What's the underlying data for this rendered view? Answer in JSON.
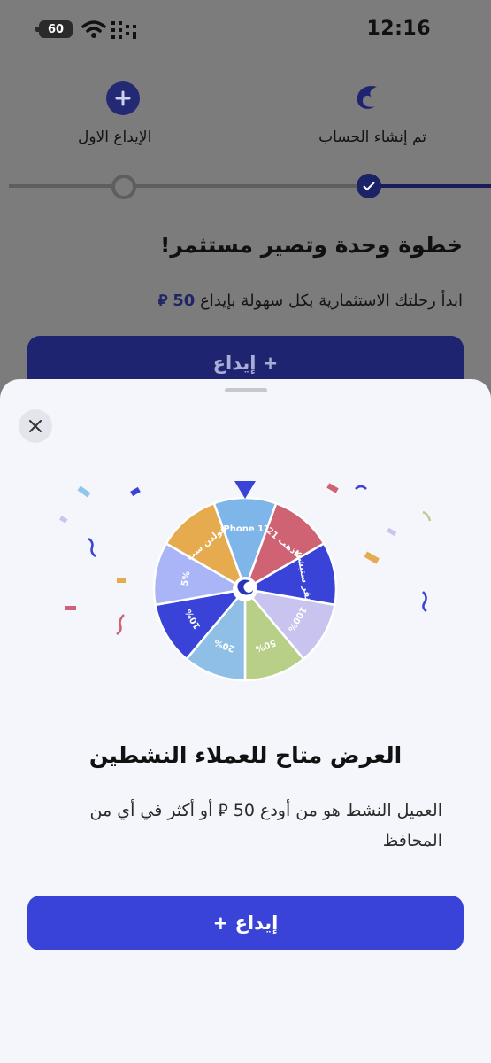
{
  "status_bar": {
    "time": "12:16",
    "battery": "60"
  },
  "background": {
    "steps": [
      {
        "label": "تم إنشاء الحساب"
      },
      {
        "label": "الإيداع الاول"
      }
    ],
    "heading": "خطوة وحدة وتصير مستثمر!",
    "subtitle_text": "ابدأ رحلتك الاستثمارية بكل سهولة بإيداع",
    "subtitle_amount": "50",
    "deposit_button": "إيداع +"
  },
  "sheet": {
    "wheel_segments": [
      {
        "label": "iPhone 17",
        "color": "#7fb6ea"
      },
      {
        "label": "ذهب 21K",
        "color": "#cf6273"
      },
      {
        "label": "هنقر ستيشن",
        "color": "#3a43d8"
      },
      {
        "label": "100%",
        "color": "#c9c3f0"
      },
      {
        "label": "50%",
        "color": "#b7cf86"
      },
      {
        "label": "20%",
        "color": "#8fbfe6"
      },
      {
        "label": "10%",
        "color": "#3a43d8"
      },
      {
        "label": "5%",
        "color": "#a9b5f7"
      },
      {
        "label": "قولدن ست",
        "color": "#e6aa4f"
      }
    ],
    "offer_title": "العرض متاح للعملاء النشطين",
    "offer_description": "العميل النشط هو من أودع 50 ⃁ أو أكثر في أي من المحافظ",
    "deposit_button": "إيداع +"
  },
  "colors": {
    "accent": "#3a43d8",
    "dark_accent": "#1f2470"
  }
}
